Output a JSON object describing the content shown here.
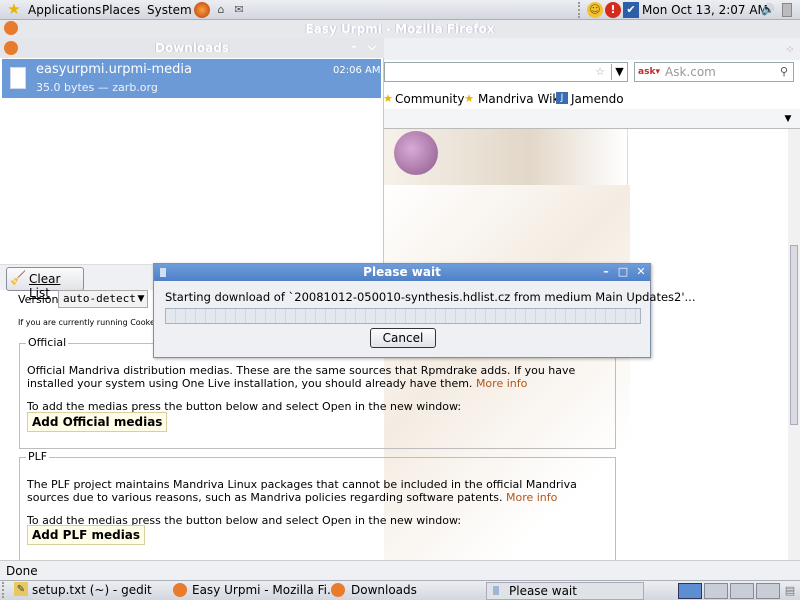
{
  "top_panel": {
    "applications": "Applications",
    "places": "Places",
    "system": "System",
    "clock": "Mon Oct 13,  2:07 AM"
  },
  "firefox": {
    "title": "Easy Urpmi - Mozilla Firefox",
    "search_placeholder": "Ask.com",
    "bookmarks": [
      "Community",
      "Mandriva Wiki",
      "Jamendo"
    ],
    "status": "Done"
  },
  "downloads": {
    "title": "Downloads",
    "item": {
      "name": "easyurpmi.urpmi-media",
      "detail": "35.0 bytes — zarb.org",
      "time": "02:06 AM"
    },
    "clear_list": "Clear List"
  },
  "page": {
    "version_label": "Version:",
    "version_value": "auto-detect",
    "cooker_note": "If you are currently running Cooker,",
    "official": {
      "legend": "Official",
      "text": "Official Mandriva distribution medias. These are the same sources that Rpmdrake adds. If you have installed your system using One Live installation, you should already have them.",
      "more": "More info",
      "instruction": "To add the medias press the button below and select Open in the new window:",
      "button": "Add Official medias"
    },
    "plf": {
      "legend": "PLF",
      "text": "The PLF project maintains Mandriva Linux packages that cannot be included in the official Mandriva sources due to various reasons, such as Mandriva policies regarding software patents.",
      "more": "More info",
      "instruction": "To add the medias press the button below and select Open in the new window:",
      "button": "Add PLF medias"
    }
  },
  "dialog": {
    "title": "Please wait",
    "message": "Starting download of `20081012-050010-synthesis.hdlist.cz from medium Main Updates2'...",
    "cancel": "Cancel",
    "progress": 0
  },
  "taskbar": [
    "setup.txt (~) - gedit",
    "Easy Urpmi - Mozilla Fi...",
    "Downloads",
    "Please wait"
  ]
}
